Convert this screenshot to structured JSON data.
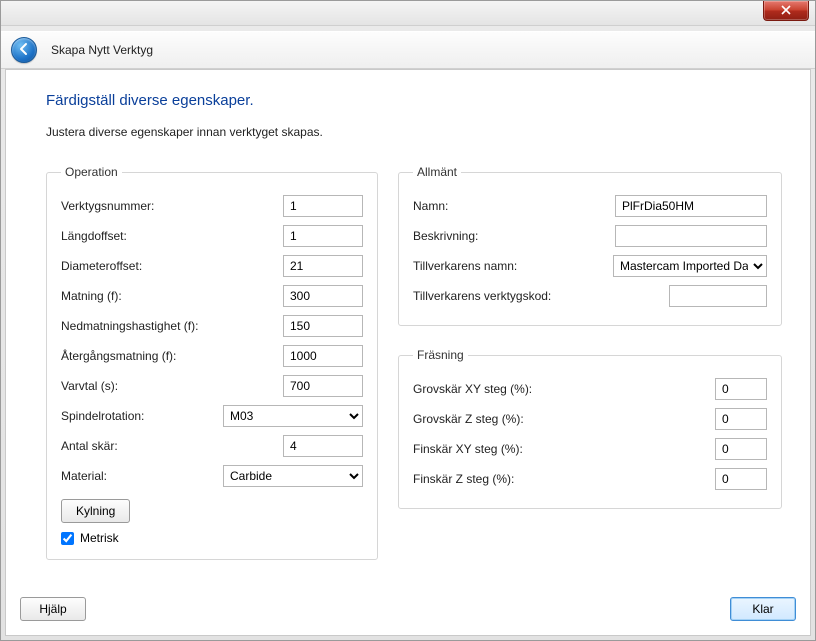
{
  "window": {
    "title": "Skapa Nytt Verktyg"
  },
  "page": {
    "heading": "Färdigställ diverse egenskaper.",
    "subheading": "Justera diverse egenskaper innan verktyget skapas."
  },
  "operation": {
    "legend": "Operation",
    "tool_number_label": "Verktygsnummer:",
    "tool_number": "1",
    "length_offset_label": "Längdoffset:",
    "length_offset": "1",
    "diameter_offset_label": "Diameteroffset:",
    "diameter_offset": "21",
    "feed_label": "Matning (f):",
    "feed": "300",
    "plunge_label": "Nedmatningshastighet (f):",
    "plunge": "150",
    "retract_label": "Återgångsmatning (f):",
    "retract": "1000",
    "rpm_label": "Varvtal (s):",
    "rpm": "700",
    "spindle_label": "Spindelrotation:",
    "spindle": "M03",
    "flutes_label": "Antal skär:",
    "flutes": "4",
    "material_label": "Material:",
    "material": "Carbide",
    "coolant_label": "Kylning",
    "metric_label": "Metrisk",
    "metric_checked": true
  },
  "general": {
    "legend": "Allmänt",
    "name_label": "Namn:",
    "name": "PlFrDia50HM",
    "desc_label": "Beskrivning:",
    "desc": "",
    "mfr_name_label": "Tillverkarens namn:",
    "mfr_name": "Mastercam Imported Dat",
    "mfr_code_label": "Tillverkarens verktygskod:",
    "mfr_code": ""
  },
  "milling": {
    "legend": "Fräsning",
    "rough_xy_label": "Grovskär XY steg (%):",
    "rough_xy": "0",
    "rough_z_label": "Grovskär Z steg (%):",
    "rough_z": "0",
    "finish_xy_label": "Finskär XY steg (%):",
    "finish_xy": "0",
    "finish_z_label": "Finskär Z steg (%):",
    "finish_z": "0"
  },
  "footer": {
    "help": "Hjälp",
    "done": "Klar"
  }
}
